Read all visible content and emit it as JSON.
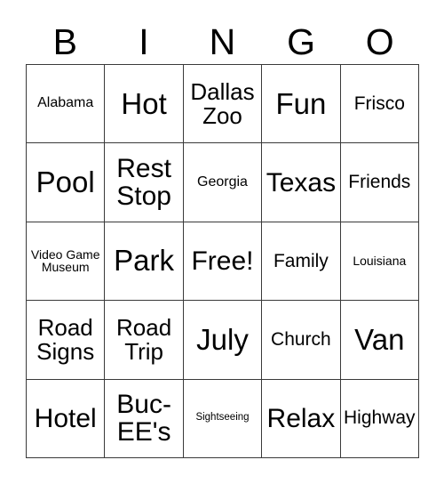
{
  "card": {
    "header_letters": [
      "B",
      "I",
      "N",
      "G",
      "O"
    ],
    "free_space_label": "Free!",
    "rows": [
      [
        {
          "text": "Alabama",
          "size": "s"
        },
        {
          "text": "Hot",
          "size": "xxl"
        },
        {
          "text": "Dallas Zoo",
          "size": "l"
        },
        {
          "text": "Fun",
          "size": "xxl"
        },
        {
          "text": "Frisco",
          "size": "m"
        }
      ],
      [
        {
          "text": "Pool",
          "size": "xxl"
        },
        {
          "text": "Rest Stop",
          "size": "xl"
        },
        {
          "text": "Georgia",
          "size": "s"
        },
        {
          "text": "Texas",
          "size": "xl"
        },
        {
          "text": "Friends",
          "size": "m"
        }
      ],
      [
        {
          "text": "Video Game Museum",
          "size": "xs"
        },
        {
          "text": "Park",
          "size": "xxl"
        },
        {
          "text": "Free!",
          "size": "xl"
        },
        {
          "text": "Family",
          "size": "m"
        },
        {
          "text": "Louisiana",
          "size": "xs"
        }
      ],
      [
        {
          "text": "Road Signs",
          "size": "l"
        },
        {
          "text": "Road Trip",
          "size": "l"
        },
        {
          "text": "July",
          "size": "xxl"
        },
        {
          "text": "Church",
          "size": "m"
        },
        {
          "text": "Van",
          "size": "xxl"
        }
      ],
      [
        {
          "text": "Hotel",
          "size": "xl"
        },
        {
          "text": "Buc-EE's",
          "size": "xl"
        },
        {
          "text": "Sightseeing",
          "size": "xxs"
        },
        {
          "text": "Relax",
          "size": "xl"
        },
        {
          "text": "Highway",
          "size": "m"
        }
      ]
    ],
    "colors": {
      "grid_line": "#3a3a3a",
      "text": "#000000",
      "background": "#ffffff"
    }
  }
}
